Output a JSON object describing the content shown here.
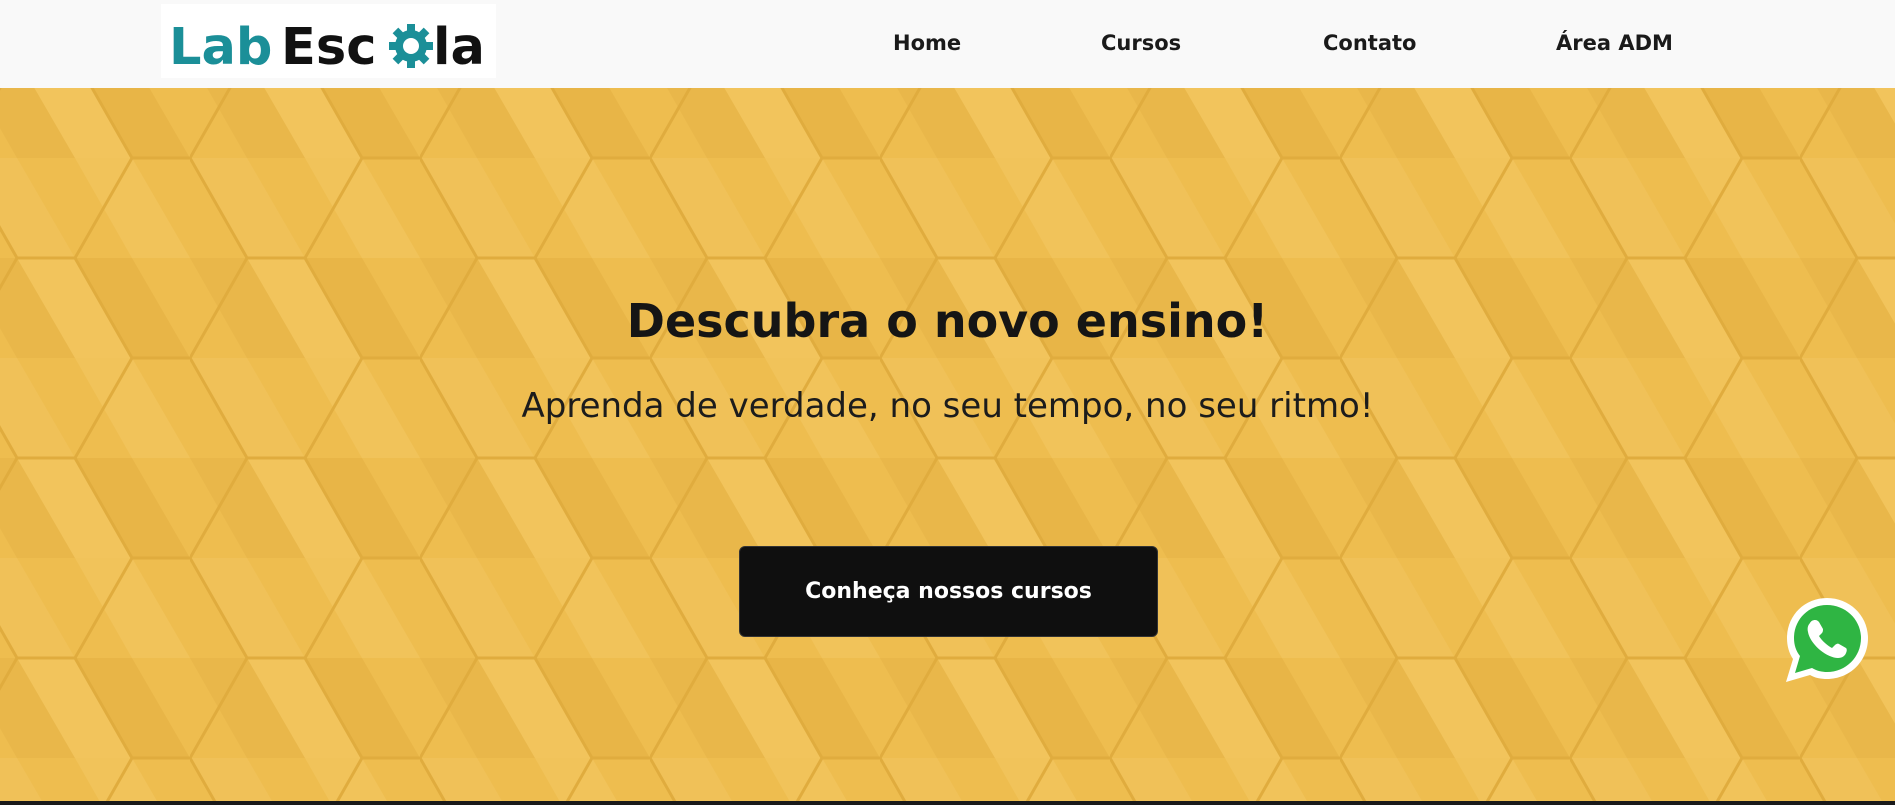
{
  "brand": {
    "logo_text_part1": "Lab",
    "logo_text_part2": "Esc",
    "logo_text_part3": "la"
  },
  "nav": {
    "items": [
      {
        "label": "Home"
      },
      {
        "label": "Cursos"
      },
      {
        "label": "Contato"
      },
      {
        "label": "Área ADM"
      }
    ]
  },
  "hero": {
    "title": "Descubra o novo ensino!",
    "subtitle": "Aprenda de verdade, no seu tempo, no seu ritmo!",
    "cta_label": "Conheça nossos cursos"
  },
  "floating": {
    "icon": "whatsapp-icon"
  },
  "colors": {
    "hero_background": "#eebd4f",
    "logo_teal": "#1b8f98",
    "logo_black": "#111111",
    "cta_background": "#0f0f0f",
    "whatsapp_green": "#2fb543"
  }
}
